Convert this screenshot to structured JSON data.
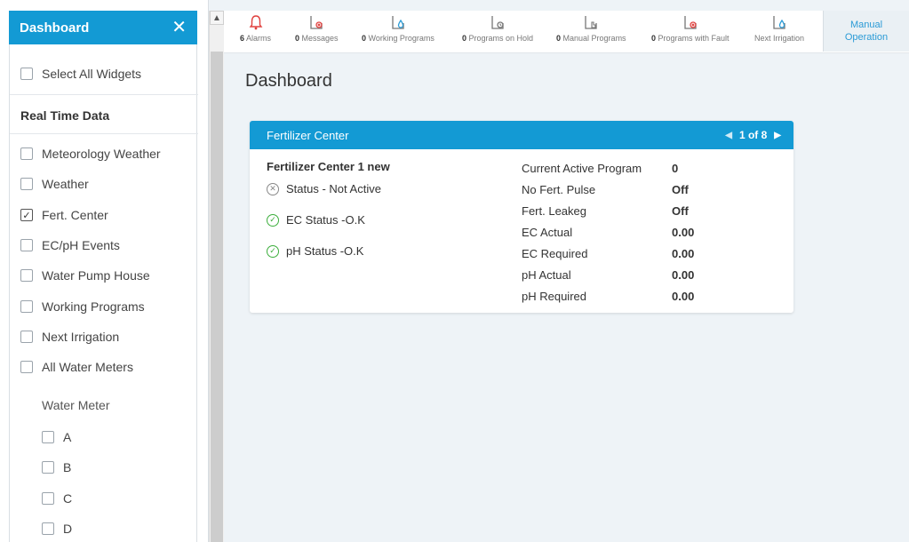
{
  "sidebar": {
    "title": "Dashboard",
    "close_label": "✕",
    "select_all": "Select All Widgets",
    "real_time_title": "Real Time Data",
    "widgets": [
      {
        "label": "Meteorology Weather",
        "checked": false
      },
      {
        "label": "Weather",
        "checked": false
      },
      {
        "label": "Fert. Center",
        "checked": true
      },
      {
        "label": "EC/pH Events",
        "checked": false
      },
      {
        "label": "Water Pump House",
        "checked": false
      },
      {
        "label": "Working Programs",
        "checked": false
      },
      {
        "label": "Next Irrigation",
        "checked": false
      },
      {
        "label": "All Water Meters",
        "checked": false
      }
    ],
    "water_meter_title": "Water Meter",
    "meters": [
      "A",
      "B",
      "C",
      "D"
    ]
  },
  "topbar": {
    "items": [
      {
        "count": "6",
        "label": "Alarms",
        "icon": "bell-icon",
        "color": "#e0413e"
      },
      {
        "count": "0",
        "label": "Messages",
        "icon": "message-x-icon",
        "color": "#e0413e"
      },
      {
        "count": "0",
        "label": "Working Programs",
        "icon": "drop-icon",
        "color": "#2b9bd6"
      },
      {
        "count": "0",
        "label": "Programs on Hold",
        "icon": "clock-icon",
        "color": "#777777"
      },
      {
        "count": "0",
        "label": "Manual Programs",
        "icon": "hand-icon",
        "color": "#777777"
      },
      {
        "count": "0",
        "label": "Programs with Fault",
        "icon": "fault-icon",
        "color": "#e0413e"
      },
      {
        "count": "",
        "label": "Next Irrigation",
        "icon": "drop-icon",
        "color": "#2b9bd6"
      }
    ],
    "manual_line1": "Manual",
    "manual_line2": "Operation"
  },
  "main": {
    "title": "Dashboard"
  },
  "card": {
    "title": "Fertilizer Center",
    "pager": "1 of 8",
    "device_name": "Fertilizer Center 1 new",
    "statuses": [
      {
        "label": "Status - Not Active",
        "state": "inactive"
      },
      {
        "label": "EC Status -O.K",
        "state": "ok"
      },
      {
        "label": "pH Status -O.K",
        "state": "ok"
      }
    ],
    "fields": [
      {
        "label": "Current Active Program",
        "value": "0"
      },
      {
        "label": "No Fert. Pulse",
        "value": "Off"
      },
      {
        "label": "Fert. Leakeg",
        "value": "Off"
      },
      {
        "label": "EC Actual",
        "value": "0.00"
      },
      {
        "label": "EC Required",
        "value": "0.00"
      },
      {
        "label": "pH Actual",
        "value": "0.00"
      },
      {
        "label": "pH Required",
        "value": "0.00"
      }
    ]
  },
  "colors": {
    "accent": "#139ad4",
    "ok": "#3cae3c",
    "alarm": "#e0413e"
  }
}
